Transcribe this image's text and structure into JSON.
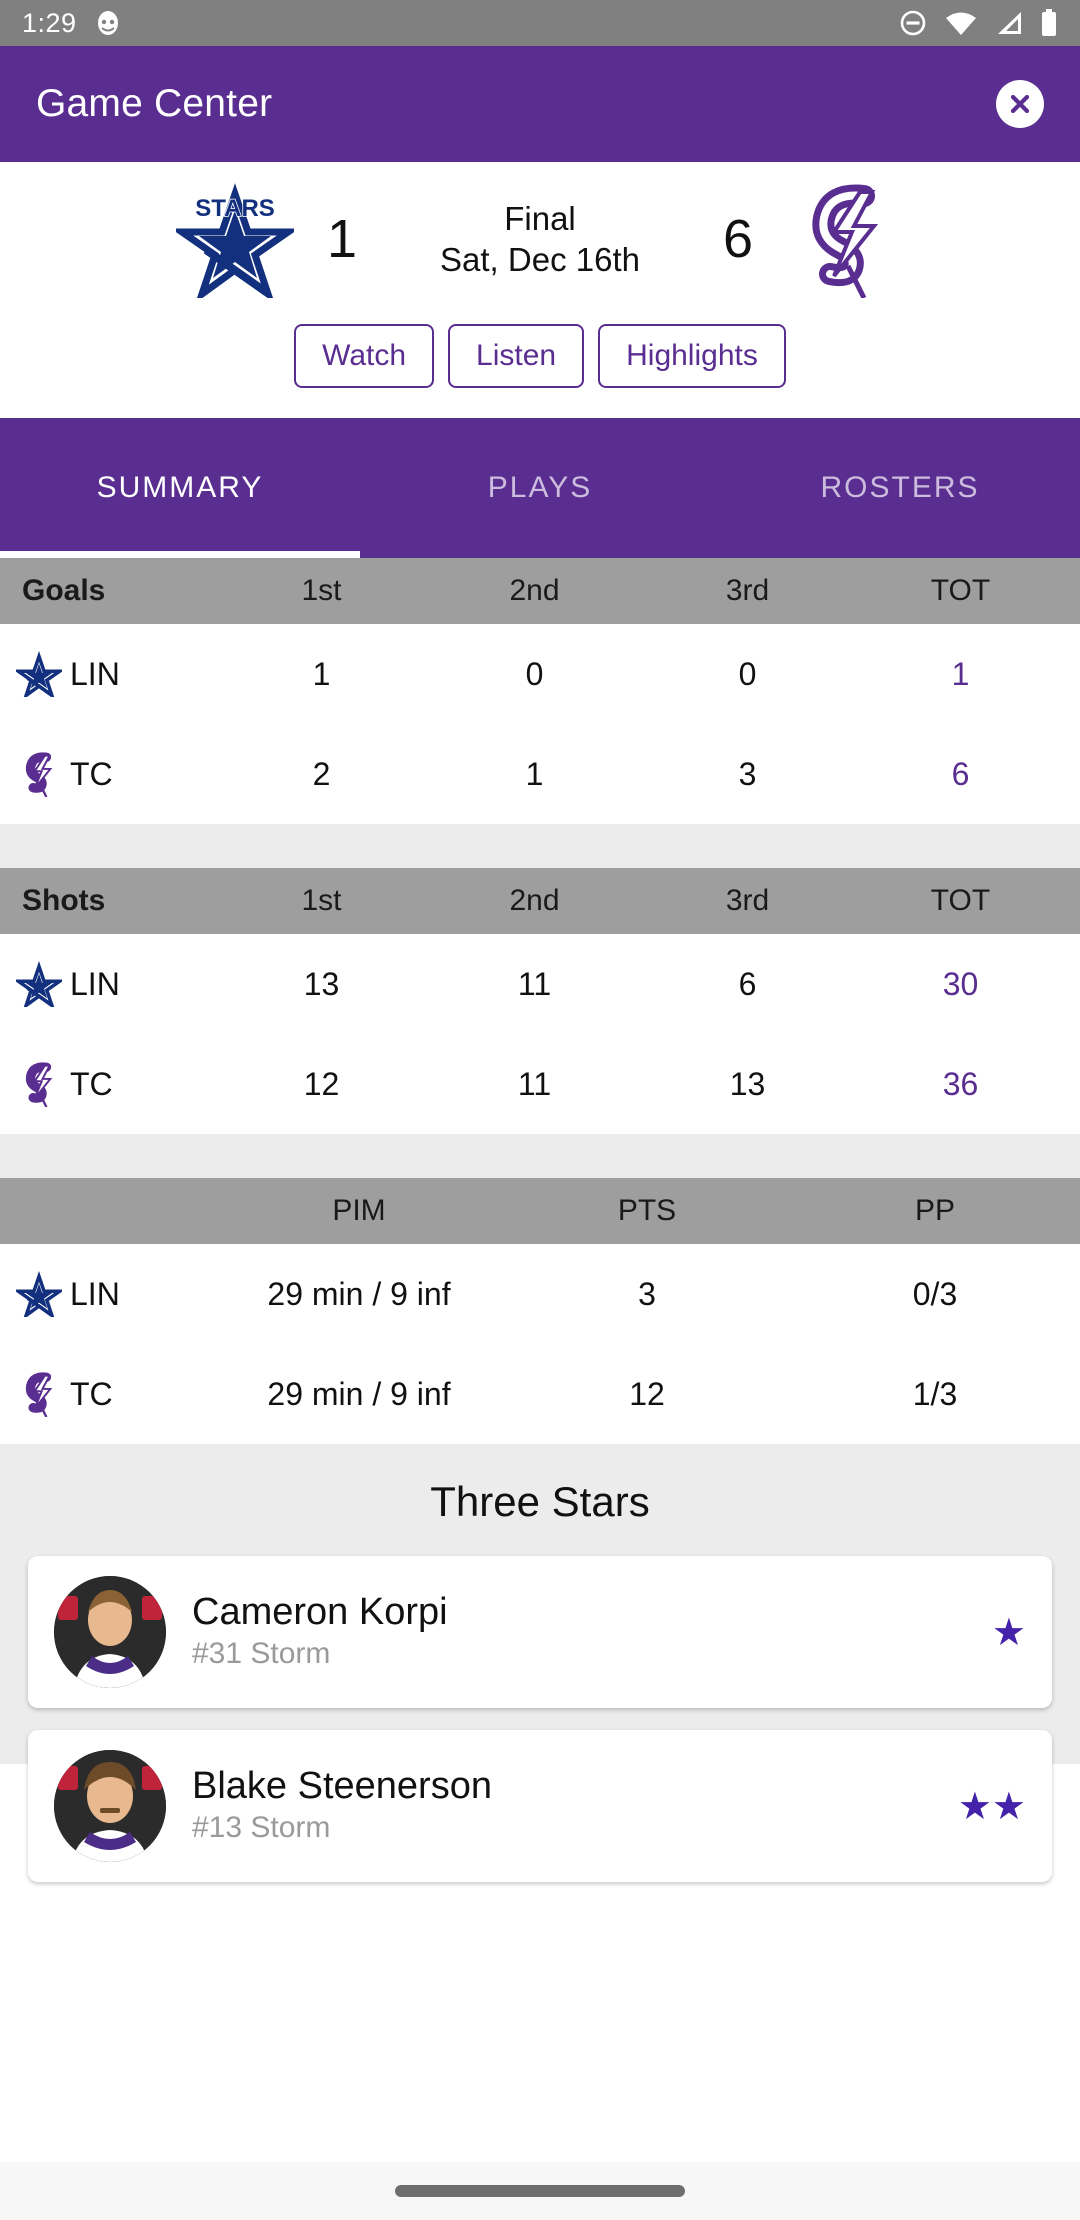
{
  "status_bar": {
    "time": "1:29",
    "icons": [
      "app-notification-icon",
      "do-not-disturb-icon",
      "wifi-icon",
      "cellular-signal-icon",
      "battery-icon"
    ]
  },
  "app_bar": {
    "title": "Game Center",
    "close_label": "×"
  },
  "scoreboard": {
    "away": {
      "abbr": "LIN",
      "name": "Stars",
      "score": "1",
      "logo": "stars-logo"
    },
    "home": {
      "abbr": "TC",
      "name": "Storm",
      "score": "6",
      "logo": "storm-logo"
    },
    "status": "Final",
    "date": "Sat, Dec 16th",
    "actions": [
      "Watch",
      "Listen",
      "Highlights"
    ]
  },
  "tabs": [
    {
      "label": "SUMMARY",
      "active": true
    },
    {
      "label": "PLAYS",
      "active": false
    },
    {
      "label": "ROSTERS",
      "active": false
    }
  ],
  "goals_table": {
    "label": "Goals",
    "columns": [
      "1st",
      "2nd",
      "3rd",
      "TOT"
    ],
    "rows": [
      {
        "team": "LIN",
        "values": [
          "1",
          "0",
          "0"
        ],
        "total": "1"
      },
      {
        "team": "TC",
        "values": [
          "2",
          "1",
          "3"
        ],
        "total": "6"
      }
    ]
  },
  "shots_table": {
    "label": "Shots",
    "columns": [
      "1st",
      "2nd",
      "3rd",
      "TOT"
    ],
    "rows": [
      {
        "team": "LIN",
        "values": [
          "13",
          "11",
          "6"
        ],
        "total": "30"
      },
      {
        "team": "TC",
        "values": [
          "12",
          "11",
          "13"
        ],
        "total": "36"
      }
    ]
  },
  "penalties_table": {
    "label": "",
    "columns": [
      "PIM",
      "PTS",
      "PP"
    ],
    "rows": [
      {
        "team": "LIN",
        "values": [
          "29 min / 9 inf",
          "3",
          "0/3"
        ]
      },
      {
        "team": "TC",
        "values": [
          "29 min / 9 inf",
          "12",
          "1/3"
        ]
      }
    ]
  },
  "three_stars": {
    "title": "Three Stars",
    "players": [
      {
        "name": "Cameron Korpi",
        "meta": "#31 Storm",
        "stars": "★"
      },
      {
        "name": "Blake Steenerson",
        "meta": "#13 Storm",
        "stars": "★★"
      }
    ]
  },
  "colors": {
    "brand_purple": "#5a2d91",
    "header_gray": "#9e9e9e",
    "status_gray": "#808080",
    "accent_star": "#4422aa"
  }
}
